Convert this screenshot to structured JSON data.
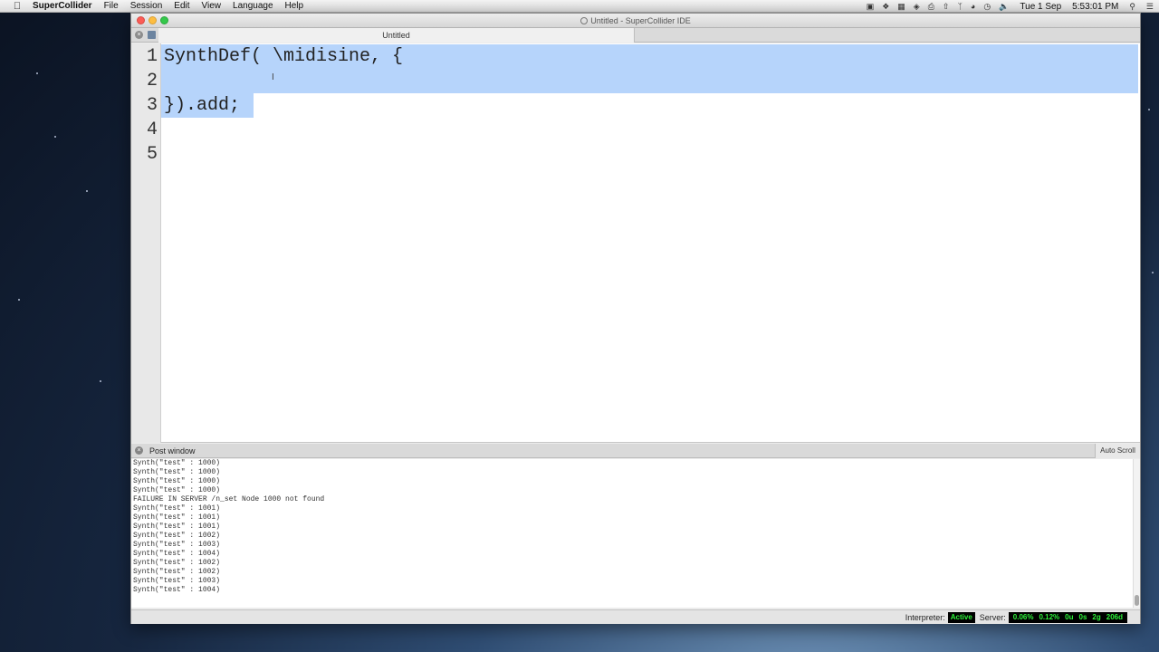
{
  "menubar": {
    "app_name": "SuperCollider",
    "items": [
      "File",
      "Session",
      "Edit",
      "View",
      "Language",
      "Help"
    ],
    "clock_day": "Tue 1 Sep",
    "clock_time": "5:53:01 PM"
  },
  "window": {
    "title": "Untitled - SuperCollider IDE",
    "tab_label": "Untitled"
  },
  "editor": {
    "lines": [
      {
        "number": "1",
        "code": "SynthDef( \\midisine, {"
      },
      {
        "number": "2",
        "code": ""
      },
      {
        "number": "3",
        "code": "}).add;"
      },
      {
        "number": "4",
        "code": ""
      },
      {
        "number": "5",
        "code": ""
      }
    ],
    "selection_color": "#b6d4fb"
  },
  "post_window": {
    "title": "Post window",
    "auto_scroll_label": "Auto Scroll",
    "lines": [
      "Synth(\"test\" : 1000)",
      "Synth(\"test\" : 1000)",
      "Synth(\"test\" : 1000)",
      "Synth(\"test\" : 1000)",
      "FAILURE IN SERVER /n_set Node 1000 not found",
      "Synth(\"test\" : 1001)",
      "Synth(\"test\" : 1001)",
      "Synth(\"test\" : 1001)",
      "Synth(\"test\" : 1002)",
      "Synth(\"test\" : 1003)",
      "Synth(\"test\" : 1004)",
      "Synth(\"test\" : 1002)",
      "Synth(\"test\" : 1002)",
      "Synth(\"test\" : 1003)",
      "Synth(\"test\" : 1004)"
    ]
  },
  "statusbar": {
    "interpreter_label": "Interpreter:",
    "interpreter_status": "Active",
    "server_label": "Server:",
    "server_stats": [
      "0.06%",
      "0.12%",
      "0u",
      "0s",
      "2g",
      "206d"
    ],
    "status_color": "#2df33a"
  }
}
